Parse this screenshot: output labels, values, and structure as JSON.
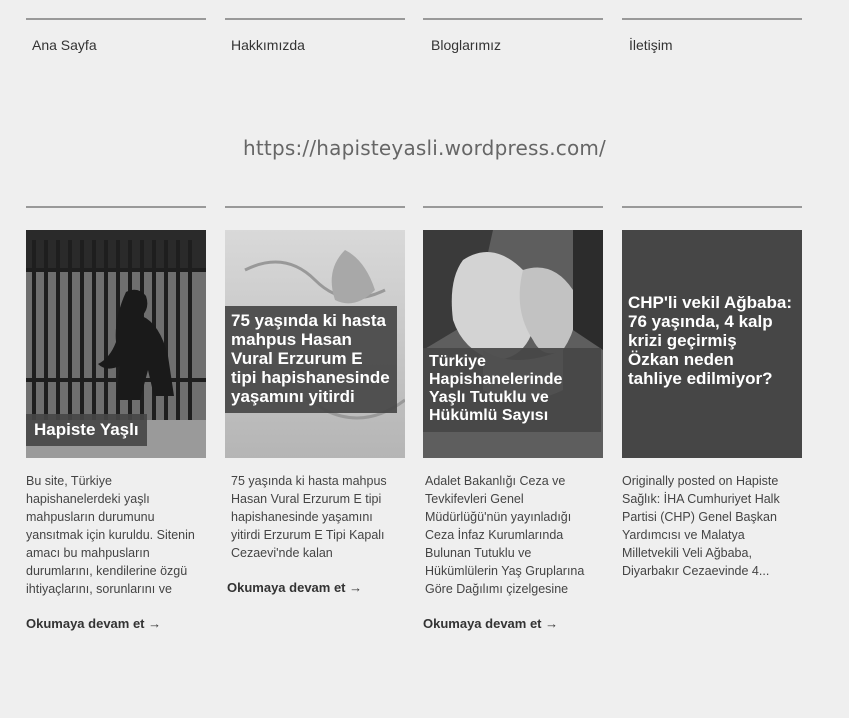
{
  "nav": {
    "items": [
      "Ana Sayfa",
      "Hakkımızda",
      "Bloglarımız",
      "İletişim"
    ]
  },
  "site": {
    "url": "https://hapisteyasli.wordpress.com/"
  },
  "posts": [
    {
      "title": "Hapiste Yaşlı",
      "excerpt": "Bu site, Türkiye hapishanelerdeki yaşlı mahpusların durumunu yansıtmak için kuruldu. Sitenin amacı bu mahpusların durumlarını, kendilerine özgü ihtiyaçlarını, sorunlarını ve",
      "read_more": "Okumaya devam et →"
    },
    {
      "title": "75 yaşında ki hasta mahpus Hasan Vural Erzurum E tipi hapishanesinde yaşamını yitirdi",
      "excerpt": " 75 yaşında ki hasta mahpus Hasan Vural Erzurum E tipi hapishanesinde yaşamını yitirdi Erzurum E Tipi Kapalı Cezaevi'nde kalan",
      "read_more": "Okumaya devam et →"
    },
    {
      "title": "Türkiye Hapishanelerinde Yaşlı Tutuklu ve Hükümlü Sayısı",
      "excerpt": "Adalet Bakanlığı Ceza ve Tevkifevleri Genel Müdürlüğü'nün yayınladığı Ceza İnfaz Kurumlarında Bulunan Tutuklu ve Hükümlülerin Yaş Gruplarına Göre Dağılımı çizelgesine",
      "read_more": "Okumaya devam et →"
    },
    {
      "title": "CHP'li vekil Ağbaba: 76 yaşında, 4 kalp krizi geçirmiş Özkan neden tahliye edilmiyor?",
      "excerpt": "Originally posted on Hapiste Sağlık: İHA Cumhuriyet Halk Partisi (CHP) Genel Başkan Yardımcısı ve Malatya Milletvekili Veli Ağbaba, Diyarbakır Cezaevinde 4...",
      "read_more": ""
    }
  ]
}
